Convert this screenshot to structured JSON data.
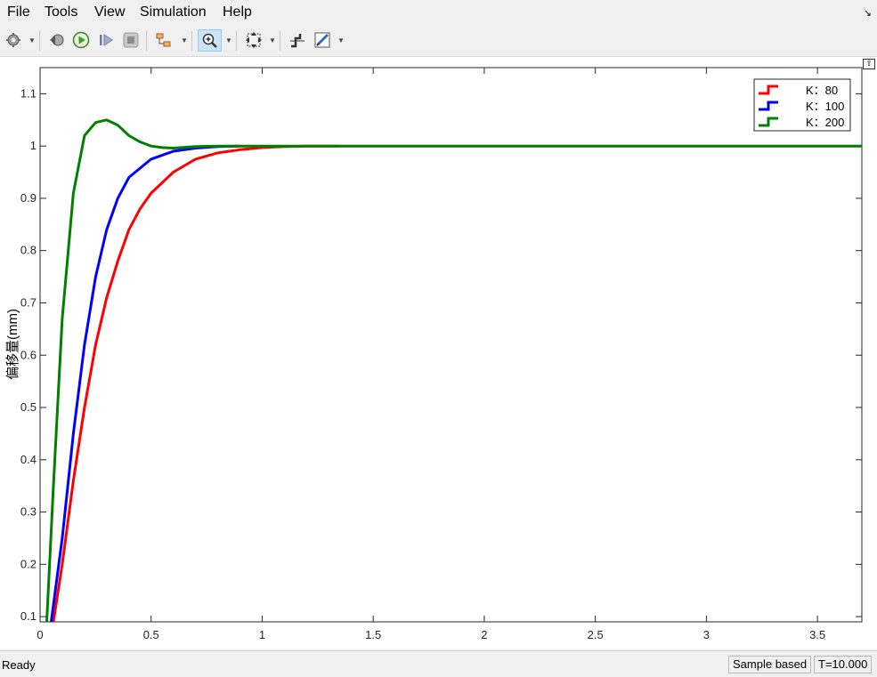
{
  "menu": {
    "items": [
      "File",
      "Tools",
      "View",
      "Simulation",
      "Help"
    ]
  },
  "toolbar": {
    "icons": [
      "settings-icon",
      "step-back-icon",
      "run-icon",
      "step-forward-icon",
      "stop-icon",
      "highlight-block-icon",
      "zoom-in-icon",
      "fit-to-view-icon",
      "cursor-measure-icon",
      "style-icon"
    ],
    "active": "zoom-in-icon"
  },
  "status": {
    "ready": "Ready",
    "sample_mode": "Sample based",
    "time": "T=10.000"
  },
  "chart_data": {
    "type": "line",
    "title": "",
    "xlabel": "",
    "ylabel": "偏移量(mm)",
    "xlim": [
      0,
      3.7
    ],
    "ylim": [
      0.09,
      1.15
    ],
    "xticks": [
      0,
      0.5,
      1,
      1.5,
      2,
      2.5,
      3,
      3.5
    ],
    "xtick_labels": [
      "0",
      "0.5",
      "1",
      "1.5",
      "2",
      "2.5",
      "3",
      "3.5"
    ],
    "yticks": [
      0.1,
      0.2,
      0.3,
      0.4,
      0.5,
      0.6,
      0.7,
      0.8,
      0.9,
      1,
      1.1
    ],
    "ytick_labels": [
      "0.1",
      "0.2",
      "0.3",
      "0.4",
      "0.5",
      "0.6",
      "0.7",
      "0.8",
      "0.9",
      "1",
      "1.1"
    ],
    "grid": false,
    "legend_position": "top-right",
    "background": "#ffffff",
    "series": [
      {
        "name": "K：80",
        "color": "#ff0000",
        "x": [
          0.06,
          0.1,
          0.15,
          0.2,
          0.25,
          0.3,
          0.35,
          0.4,
          0.45,
          0.5,
          0.6,
          0.7,
          0.8,
          0.9,
          1.0,
          1.1,
          1.2,
          1.35
        ],
        "y": [
          0.09,
          0.2,
          0.36,
          0.5,
          0.62,
          0.71,
          0.78,
          0.84,
          0.88,
          0.91,
          0.95,
          0.975,
          0.987,
          0.993,
          0.997,
          0.999,
          1.0,
          1.0
        ]
      },
      {
        "name": "K：100",
        "color": "#0000ff",
        "x": [
          0.05,
          0.1,
          0.15,
          0.2,
          0.25,
          0.3,
          0.35,
          0.4,
          0.5,
          0.6,
          0.7,
          0.8,
          0.9
        ],
        "y": [
          0.09,
          0.25,
          0.45,
          0.62,
          0.75,
          0.84,
          0.9,
          0.94,
          0.975,
          0.99,
          0.996,
          0.999,
          1.0
        ]
      },
      {
        "name": "K：200",
        "color": "#008000",
        "x": [
          0.03,
          0.06,
          0.1,
          0.15,
          0.2,
          0.25,
          0.3,
          0.35,
          0.4,
          0.45,
          0.5,
          0.55,
          0.6,
          0.7,
          0.8,
          1.0,
          3.7
        ],
        "y": [
          0.09,
          0.35,
          0.67,
          0.91,
          1.02,
          1.045,
          1.05,
          1.04,
          1.02,
          1.008,
          1.0,
          0.997,
          0.996,
          0.999,
          1.0,
          1.0,
          1.0
        ]
      }
    ]
  }
}
